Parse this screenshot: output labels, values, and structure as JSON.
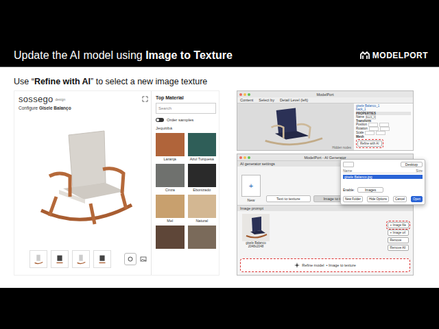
{
  "slide": {
    "title_prefix": "Update the AI model using ",
    "title_bold": "Image to Texture",
    "logo": "MODELPORT",
    "subtitle_prefix": "Use “",
    "subtitle_bold": "Refine with AI",
    "subtitle_suffix": "” to select a new image texture"
  },
  "configurator": {
    "brand": "sossego",
    "brand_tag": "design",
    "title_prefix": "Configure ",
    "title_bold": "Gisele Balanço",
    "material_title": "Top Material",
    "search_placeholder": "Search",
    "toggle": {
      "label": "Order samples",
      "on": false
    },
    "group": "Jequitibá",
    "thumbnails": [
      {
        "selected": false
      },
      {
        "selected": false
      },
      {
        "selected": false
      },
      {
        "selected": false
      }
    ],
    "swatches": [
      {
        "name": "Laranja",
        "color": "#b0643a"
      },
      {
        "name": "Azul Turquesa",
        "color": "#2f5e58"
      },
      {
        "name": "Cinza",
        "color": "#6f716e"
      },
      {
        "name": "Ebonizado",
        "color": "#2a2a2a"
      },
      {
        "name": "Mel",
        "color": "#c8a06e"
      },
      {
        "name": "Natural",
        "color": "#d3b792"
      },
      {
        "color": "#5e4638"
      },
      {
        "color": "#7a6a5a"
      }
    ]
  },
  "modelport": {
    "title": "ModelPort",
    "toolbar": [
      "Content",
      "Select by",
      "Detail Level (left)"
    ],
    "hierarchy": [
      "gisele Balanco_1",
      "back_1"
    ],
    "properties_title": "PROPERTIES",
    "name_label": "Name",
    "name_value": "back_0",
    "transform": "Transform",
    "rows": [
      "Position",
      "Rotation",
      "Scale"
    ],
    "mesh": "Mesh",
    "refine_button": "Refine with AI",
    "status": "Hidden nodes"
  },
  "ai_generator": {
    "title": "ModelPort - AI Generator",
    "settings_title": "AI generator settings",
    "new_label": "New",
    "plus": "+",
    "modes": [
      {
        "label": "Text to texture",
        "selected": false
      },
      {
        "label": "Image to texture",
        "selected": true
      }
    ],
    "prompt_title": "Image prompt",
    "image_caption": "gisele Balanco",
    "image_size": "2048x2048",
    "side_buttons": [
      "+ Image file",
      "+ Image url",
      "Remove",
      "Remove All"
    ],
    "refine_label": "Refine model",
    "refine_mode": "Image to texture"
  },
  "file_dialog": {
    "location": "Desktop",
    "columns": [
      "Name",
      "Size"
    ],
    "files": [
      {
        "name": "gisele Balanco.jpg",
        "selected": true
      }
    ],
    "enable_label": "Enable:",
    "enable_value": "Images",
    "buttons": [
      "New Folder",
      "Hide Options",
      "Cancel",
      "Open"
    ]
  }
}
